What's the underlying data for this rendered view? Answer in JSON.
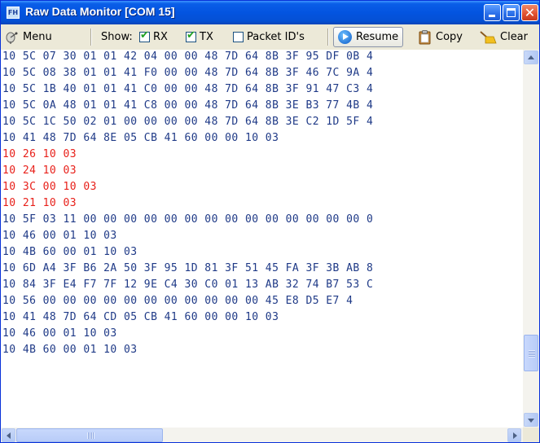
{
  "window": {
    "title": "Raw Data Monitor [COM 15]",
    "icon_text": "FH",
    "controls": [
      "minimize-icon",
      "maximize-icon",
      "close-icon"
    ]
  },
  "toolbar": {
    "menu_label": "Menu",
    "show_label": "Show:",
    "rx_label": "RX",
    "rx_checked": true,
    "tx_label": "TX",
    "tx_checked": true,
    "packet_ids_label": "Packet ID's",
    "packet_ids_checked": false,
    "resume_label": "Resume",
    "copy_label": "Copy",
    "clear_label": "Clear",
    "icons": {
      "menu": "satellite-dish-icon",
      "resume": "play-icon",
      "copy": "clipboard-icon",
      "clear": "broom-icon"
    }
  },
  "colors": {
    "hex_text": "#1f3a87",
    "highlight_text": "#e8201a",
    "title_bar": "#0354e0"
  },
  "data_lines": [
    {
      "text": "10 5C 07 30 01 01 42 04 00 00 48 7D 64 8B 3F 95 DF 0B 4",
      "highlight": false
    },
    {
      "text": "10 5C 08 38 01 01 41 F0 00 00 48 7D 64 8B 3F 46 7C 9A 4",
      "highlight": false
    },
    {
      "text": "10 5C 1B 40 01 01 41 C0 00 00 48 7D 64 8B 3F 91 47 C3 4",
      "highlight": false
    },
    {
      "text": "10 5C 0A 48 01 01 41 C8 00 00 48 7D 64 8B 3E B3 77 4B 4",
      "highlight": false
    },
    {
      "text": "10 5C 1C 50 02 01 00 00 00 00 48 7D 64 8B 3E C2 1D 5F 4",
      "highlight": false
    },
    {
      "text": "10 41 48 7D 64 8E 05 CB 41 60 00 00 10 03",
      "highlight": false
    },
    {
      "text": "10 26 10 03",
      "highlight": true
    },
    {
      "text": "10 24 10 03",
      "highlight": true
    },
    {
      "text": "10 3C 00 10 03",
      "highlight": true
    },
    {
      "text": "10 21 10 03",
      "highlight": true
    },
    {
      "text": "10 5F 03 11 00 00 00 00 00 00 00 00 00 00 00 00 00 00 0",
      "highlight": false
    },
    {
      "text": "10 46 00 01 10 03",
      "highlight": false
    },
    {
      "text": "10 4B 60 00 01 10 03",
      "highlight": false
    },
    {
      "text": "10 6D A4 3F B6 2A 50 3F 95 1D 81 3F 51 45 FA 3F 3B AB 8",
      "highlight": false
    },
    {
      "text": "10 84 3F E4 F7 7F 12 9E C4 30 C0 01 13 AB 32 74 B7 53 C",
      "highlight": false
    },
    {
      "text": "10 56 00 00 00 00 00 00 00 00 00 00 00 45 E8 D5 E7 4",
      "highlight": false
    },
    {
      "text": "10 41 48 7D 64 CD 05 CB 41 60 00 00 10 03",
      "highlight": false
    },
    {
      "text": "10 46 00 01 10 03",
      "highlight": false
    },
    {
      "text": "10 4B 60 00 01 10 03",
      "highlight": false
    }
  ]
}
